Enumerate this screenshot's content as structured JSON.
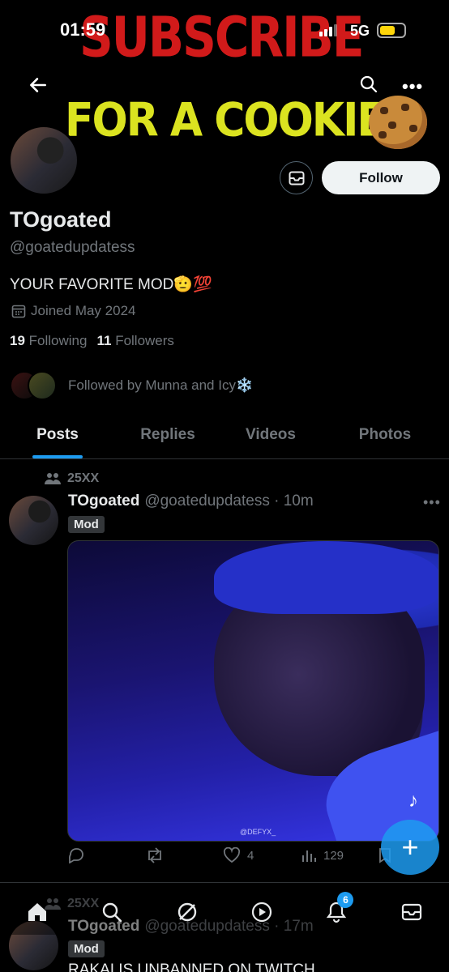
{
  "status_bar": {
    "time": "01:59",
    "network": "5G"
  },
  "banner": {
    "line1": "SUBSCRIBE",
    "line2": "FOR A COOKIE"
  },
  "profile": {
    "display_name": "TOgoated",
    "handle": "@goatedupdatess",
    "bio": "YOUR FAVORITE MOD🫡💯",
    "joined": "Joined May 2024",
    "following_count": "19",
    "following_label": "Following",
    "followers_count": "11",
    "followers_label": "Followers",
    "followed_by": "Followed by Munna and Icy❄️",
    "follow_label": "Follow"
  },
  "tabs": [
    {
      "label": "Posts",
      "active": true
    },
    {
      "label": "Replies",
      "active": false
    },
    {
      "label": "Videos",
      "active": false
    },
    {
      "label": "Photos",
      "active": false
    }
  ],
  "post1": {
    "community": "25XX",
    "name": "TOgoated",
    "meta": "@goatedupdatess · 10m",
    "badge": "Mod",
    "watermark": "@DEFYX_",
    "likes": "4",
    "views": "129"
  },
  "post2": {
    "community": "25XX",
    "name": "TOgoated",
    "meta": "@goatedupdatess · 17m",
    "badge": "Mod",
    "text": "RAKAI IS UNBANNED ON TWITCH"
  },
  "bottom_nav": {
    "notification_count": "6"
  },
  "colors": {
    "accent": "#1d9bf0",
    "background": "#000000",
    "muted": "#71767b"
  }
}
